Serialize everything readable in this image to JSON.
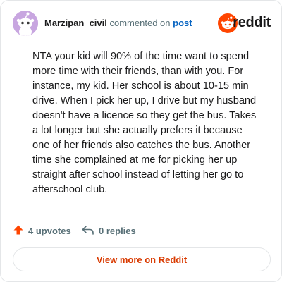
{
  "header": {
    "username": "Marzipan_civil",
    "action_text": "commented on",
    "post_link_label": "post",
    "brand_name": "reddit"
  },
  "comment": {
    "body": "NTA your kid will 90% of the time want to spend more time with their friends, than with you. For instance, my kid. Her school is about 10-15 min drive. When I pick her up, I drive but my husband doesn't have a licence so they get the bus. Takes a lot longer but she actually prefers it because one of her friends also catches the bus. Another time she complained at me for picking her up straight after school instead of letting her go to afterschool club."
  },
  "stats": {
    "upvotes_label": "4 upvotes",
    "replies_label": "0 replies"
  },
  "footer": {
    "view_more_label": "View more on Reddit"
  },
  "icons": {
    "avatar": "snoo-avatar-icon",
    "brand": "reddit-logo-icon",
    "upvote": "upvote-arrow-icon",
    "reply": "reply-arrow-icon"
  },
  "colors": {
    "brand_orange": "#ff4500",
    "upvote_orange": "#ff4500",
    "link_blue": "#0a66c2",
    "view_more_text": "#d93a00",
    "avatar_bg": "#c8a6e0",
    "muted_text": "#576f76"
  }
}
